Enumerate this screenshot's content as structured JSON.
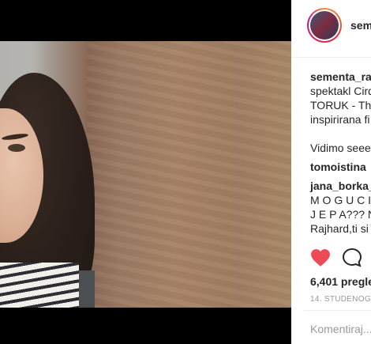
{
  "post": {
    "username": "sementa_ra",
    "caption_lines": [
      "spektakl Cirq",
      "TORUK - Th",
      "inspirirana fi",
      "",
      "Vidimo seeee"
    ],
    "comments": [
      {
        "user": "tomoistina",
        "text": ""
      },
      {
        "user": "jana_borka_",
        "lines": [
          "M O G U C I",
          "J E P A??? N",
          "Rajhard,ti si"
        ]
      }
    ],
    "views": "6,401 pregle",
    "date": "14. STUDENOGA",
    "comment_placeholder": "Komentiraj..."
  },
  "icons": {
    "like": "heart-icon",
    "comment": "speech-bubble-icon"
  },
  "colors": {
    "like_red": "#ed4956",
    "text": "#262626",
    "muted": "#999999"
  }
}
